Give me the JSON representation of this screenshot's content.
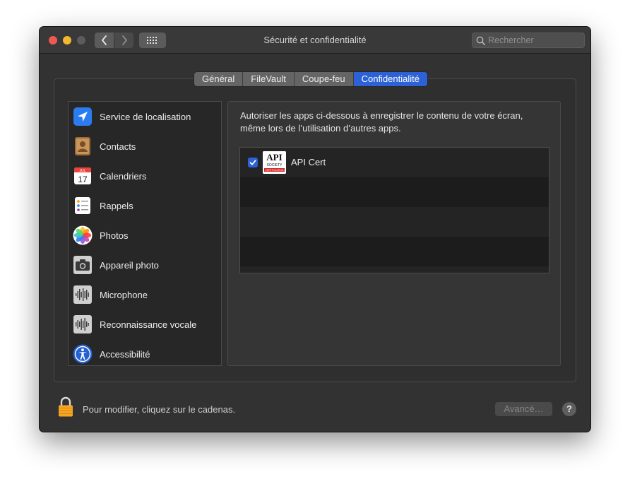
{
  "window": {
    "title": "Sécurité et confidentialité",
    "search_placeholder": "Rechercher"
  },
  "tabs": [
    {
      "label": "Général",
      "active": false
    },
    {
      "label": "FileVault",
      "active": false
    },
    {
      "label": "Coupe-feu",
      "active": false
    },
    {
      "label": "Confidentialité",
      "active": true
    }
  ],
  "sidebar": {
    "items": [
      {
        "label": "Service de localisation",
        "icon": "location-arrow-icon"
      },
      {
        "label": "Contacts",
        "icon": "contacts-book-icon"
      },
      {
        "label": "Calendriers",
        "icon": "calendar-icon",
        "month": "JUL",
        "day": "17"
      },
      {
        "label": "Rappels",
        "icon": "reminders-icon"
      },
      {
        "label": "Photos",
        "icon": "photos-icon"
      },
      {
        "label": "Appareil photo",
        "icon": "camera-icon"
      },
      {
        "label": "Microphone",
        "icon": "microphone-waveform-icon"
      },
      {
        "label": "Reconnaissance vocale",
        "icon": "speech-waveform-icon"
      },
      {
        "label": "Accessibilité",
        "icon": "accessibility-icon"
      }
    ]
  },
  "main": {
    "description": "Autoriser les apps ci-dessous à enregistrer le contenu de votre écran, même lors de l’utilisation d’autres apps.",
    "apps": [
      {
        "name": "API Cert",
        "checked": true,
        "logo_text_top": "API",
        "logo_text_mid": "SOCIETY",
        "logo_text_bottom": "CERTIFICATION"
      }
    ]
  },
  "footer": {
    "lock_text": "Pour modifier, cliquez sur le cadenas.",
    "advanced_label": "Avancé…",
    "help_label": "?"
  },
  "colors": {
    "accent": "#2c62d6",
    "close": "#ee5a52",
    "minimize": "#f1b92d",
    "lock": "#f5a623"
  }
}
